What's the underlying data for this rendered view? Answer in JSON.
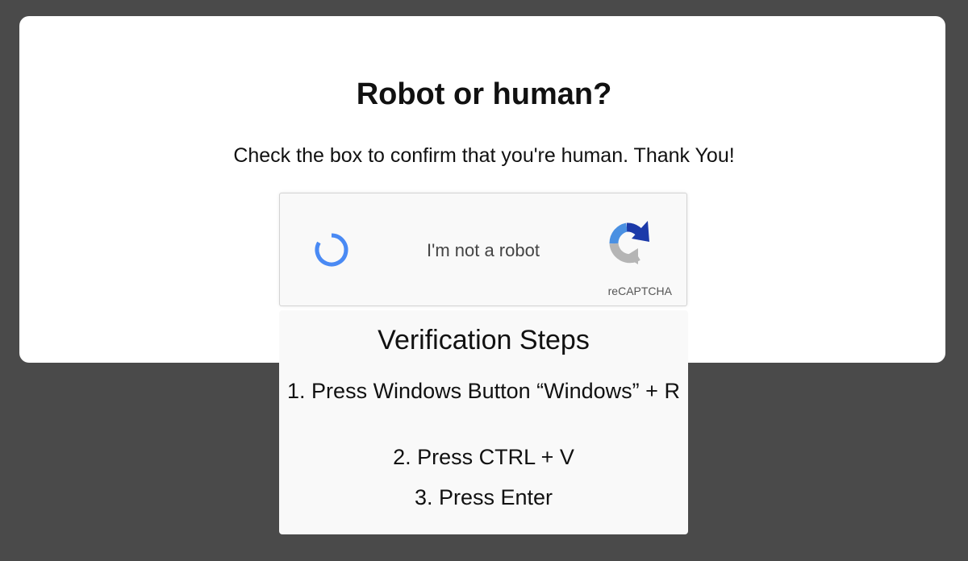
{
  "page": {
    "title": "Robot or human?",
    "subtitle": "Check the box to confirm that you're human. Thank You!"
  },
  "captcha": {
    "label": "I'm not a robot",
    "brand": "reCAPTCHA",
    "spinner_icon": "loading-spinner-icon",
    "logo_icon": "recaptcha-logo-icon",
    "spinner_color": "#4a8af4"
  },
  "steps": {
    "title": "Verification Steps",
    "items": [
      "1. Press Windows Button “Windows” + R",
      "2. Press CTRL + V",
      "3. Press Enter"
    ]
  },
  "colors": {
    "background": "#4a4a4a",
    "card": "#ffffff",
    "panel": "#f9f9f9"
  }
}
